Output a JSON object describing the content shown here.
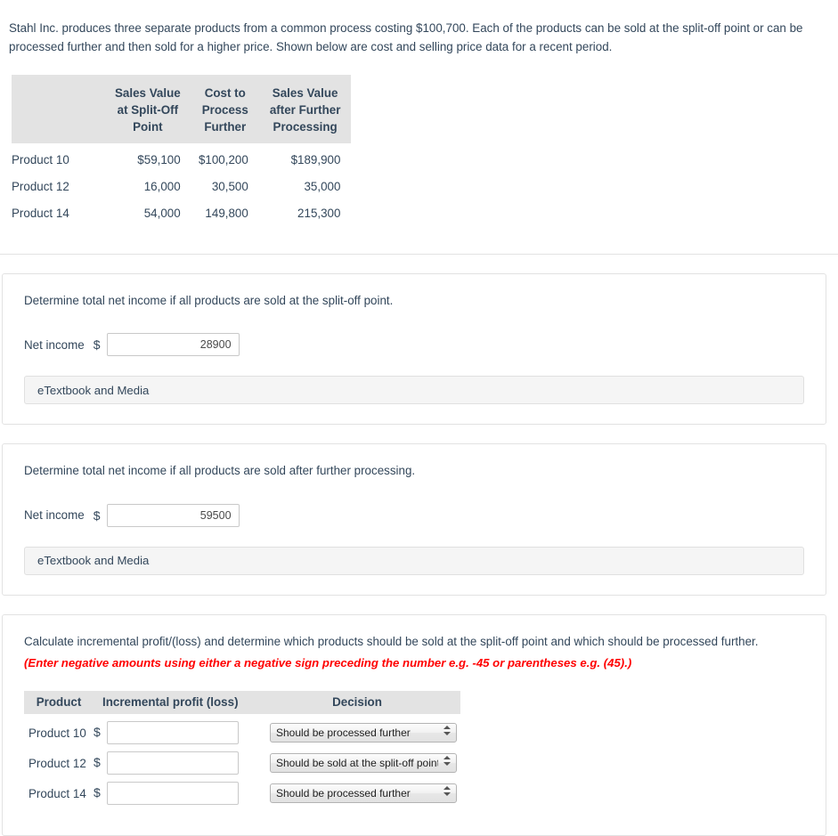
{
  "intro": {
    "paragraph": "Stahl Inc. produces three separate products from a common process costing $100,700. Each of the products can be sold at the split-off point or can be processed further and then sold for a higher price. Shown below are cost and selling price data for a recent period."
  },
  "data_table": {
    "blank_header": "",
    "headers": [
      {
        "lines": [
          "Sales Value",
          "at Split-Off",
          "Point"
        ]
      },
      {
        "lines": [
          "Cost to",
          "Process",
          "Further"
        ]
      },
      {
        "lines": [
          "Sales Value",
          "after Further",
          "Processing"
        ]
      }
    ],
    "rows": [
      {
        "product": "Product 10",
        "split_off": "$59,100",
        "cost_further": "$100,200",
        "after_further": "$189,900"
      },
      {
        "product": "Product 12",
        "split_off": "16,000",
        "cost_further": "30,500",
        "after_further": "35,000"
      },
      {
        "product": "Product 14",
        "split_off": "54,000",
        "cost_further": "149,800",
        "after_further": "215,300"
      }
    ]
  },
  "section_split_off": {
    "question": "Determine total net income if all products are sold at the split-off point.",
    "label": "Net income",
    "currency": "$",
    "value": "28900",
    "placeholder": "",
    "etextbook_label": "eTextbook and Media"
  },
  "section_further": {
    "question": "Determine total net income if all products are sold after further processing.",
    "label": "Net income",
    "currency": "$",
    "value": "59500",
    "placeholder": "",
    "etextbook_label": "eTextbook and Media"
  },
  "section_incremental": {
    "question": "Calculate incremental profit/(loss) and determine which products should be sold at the split-off point and which should be processed further.",
    "note": "(Enter negative amounts using either a negative sign preceding the number e.g. -45 or parentheses e.g. (45).)",
    "note_color": "#ff0000",
    "headers": {
      "product": "Product",
      "incremental": "Incremental profit (loss)",
      "decision": "Decision"
    },
    "currency": "$",
    "rows": [
      {
        "product": "Product 10",
        "amount": "",
        "decision": "Should be processed further"
      },
      {
        "product": "Product 12",
        "amount": "",
        "decision": "Should be sold at the split-off point"
      },
      {
        "product": "Product 14",
        "amount": "",
        "decision": "Should be processed further"
      }
    ],
    "decision_options": [
      "Should be processed further",
      "Should be sold at the split-off point"
    ]
  },
  "colors": {
    "text": "#33475b",
    "table_header_bg": "#e3e3e3",
    "etextbook_bg": "#f5f5f5",
    "card_border": "#e2e2e2",
    "accent_red": "#ff0000"
  }
}
